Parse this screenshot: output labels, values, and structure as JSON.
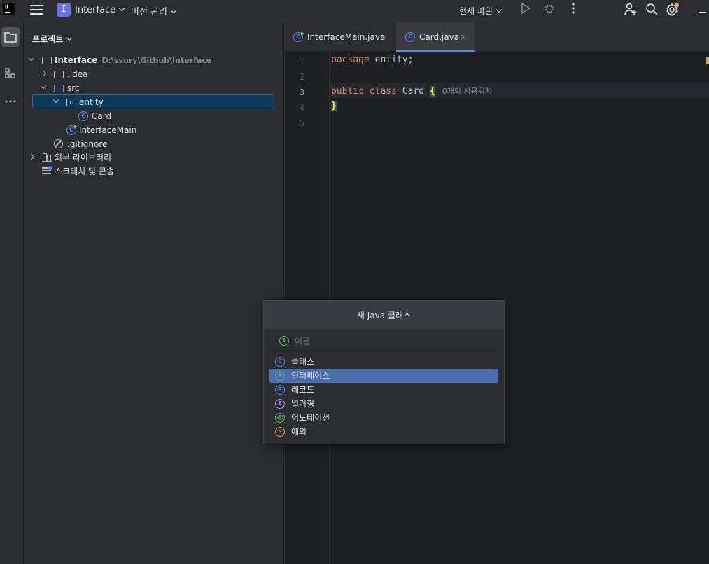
{
  "titlebar": {
    "project_badge": "I",
    "project_name": "Interface",
    "vcs_label": "버전 관리",
    "run_config": "현재 파일"
  },
  "project_panel": {
    "title": "프로젝트",
    "tree": [
      {
        "label": "Interface",
        "hint": "D:\\ssury\\Github\\Interface"
      },
      {
        "label": ".idea"
      },
      {
        "label": "src"
      },
      {
        "label": "entity"
      },
      {
        "label": "Card"
      },
      {
        "label": "InterfaceMain"
      },
      {
        "label": ".gitignore"
      },
      {
        "label": "외부 라이브러리"
      },
      {
        "label": "스크래치 및 콘솔"
      }
    ]
  },
  "editor": {
    "tabs": [
      {
        "label": "InterfaceMain.java"
      },
      {
        "label": "Card.java",
        "close": "×"
      }
    ],
    "lines": [
      "1",
      "2",
      "3",
      "4",
      "5"
    ],
    "code": {
      "line1_kw": "package",
      "line1_rest": " entity;",
      "line3_kw1": "public",
      "line3_kw2": "class",
      "line3_name": "Card",
      "line3_brace": "{",
      "line3_hint": "0개의 사용위치",
      "line4_brace": "}"
    }
  },
  "popup": {
    "title": "새 Java 클래스",
    "input_placeholder": "이름",
    "items": [
      {
        "label": "클래스",
        "glyph": "C",
        "color": "#548af7"
      },
      {
        "label": "인터페이스",
        "glyph": "I",
        "color": "#5fb865"
      },
      {
        "label": "레코드",
        "glyph": "R",
        "color": "#548af7"
      },
      {
        "label": "열거형",
        "glyph": "E",
        "color": "#b98eeb"
      },
      {
        "label": "어노테이션",
        "glyph": "@",
        "color": "#5fb865"
      },
      {
        "label": "예외",
        "glyph": "⚡",
        "color": "#e0a34a"
      }
    ],
    "selected_index": 1
  }
}
